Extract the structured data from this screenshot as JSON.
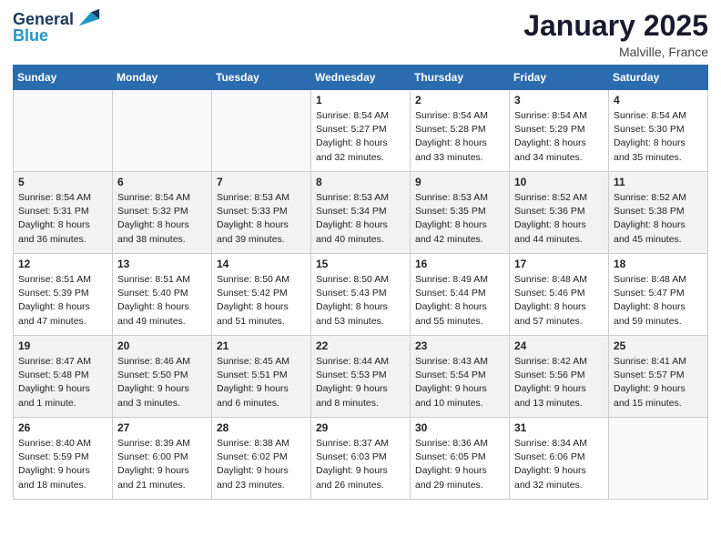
{
  "header": {
    "logo_line1": "General",
    "logo_line2": "Blue",
    "month": "January 2025",
    "location": "Malville, France"
  },
  "weekdays": [
    "Sunday",
    "Monday",
    "Tuesday",
    "Wednesday",
    "Thursday",
    "Friday",
    "Saturday"
  ],
  "weeks": [
    [
      {
        "day": "",
        "info": ""
      },
      {
        "day": "",
        "info": ""
      },
      {
        "day": "",
        "info": ""
      },
      {
        "day": "1",
        "info": "Sunrise: 8:54 AM\nSunset: 5:27 PM\nDaylight: 8 hours\nand 32 minutes."
      },
      {
        "day": "2",
        "info": "Sunrise: 8:54 AM\nSunset: 5:28 PM\nDaylight: 8 hours\nand 33 minutes."
      },
      {
        "day": "3",
        "info": "Sunrise: 8:54 AM\nSunset: 5:29 PM\nDaylight: 8 hours\nand 34 minutes."
      },
      {
        "day": "4",
        "info": "Sunrise: 8:54 AM\nSunset: 5:30 PM\nDaylight: 8 hours\nand 35 minutes."
      }
    ],
    [
      {
        "day": "5",
        "info": "Sunrise: 8:54 AM\nSunset: 5:31 PM\nDaylight: 8 hours\nand 36 minutes."
      },
      {
        "day": "6",
        "info": "Sunrise: 8:54 AM\nSunset: 5:32 PM\nDaylight: 8 hours\nand 38 minutes."
      },
      {
        "day": "7",
        "info": "Sunrise: 8:53 AM\nSunset: 5:33 PM\nDaylight: 8 hours\nand 39 minutes."
      },
      {
        "day": "8",
        "info": "Sunrise: 8:53 AM\nSunset: 5:34 PM\nDaylight: 8 hours\nand 40 minutes."
      },
      {
        "day": "9",
        "info": "Sunrise: 8:53 AM\nSunset: 5:35 PM\nDaylight: 8 hours\nand 42 minutes."
      },
      {
        "day": "10",
        "info": "Sunrise: 8:52 AM\nSunset: 5:36 PM\nDaylight: 8 hours\nand 44 minutes."
      },
      {
        "day": "11",
        "info": "Sunrise: 8:52 AM\nSunset: 5:38 PM\nDaylight: 8 hours\nand 45 minutes."
      }
    ],
    [
      {
        "day": "12",
        "info": "Sunrise: 8:51 AM\nSunset: 5:39 PM\nDaylight: 8 hours\nand 47 minutes."
      },
      {
        "day": "13",
        "info": "Sunrise: 8:51 AM\nSunset: 5:40 PM\nDaylight: 8 hours\nand 49 minutes."
      },
      {
        "day": "14",
        "info": "Sunrise: 8:50 AM\nSunset: 5:42 PM\nDaylight: 8 hours\nand 51 minutes."
      },
      {
        "day": "15",
        "info": "Sunrise: 8:50 AM\nSunset: 5:43 PM\nDaylight: 8 hours\nand 53 minutes."
      },
      {
        "day": "16",
        "info": "Sunrise: 8:49 AM\nSunset: 5:44 PM\nDaylight: 8 hours\nand 55 minutes."
      },
      {
        "day": "17",
        "info": "Sunrise: 8:48 AM\nSunset: 5:46 PM\nDaylight: 8 hours\nand 57 minutes."
      },
      {
        "day": "18",
        "info": "Sunrise: 8:48 AM\nSunset: 5:47 PM\nDaylight: 8 hours\nand 59 minutes."
      }
    ],
    [
      {
        "day": "19",
        "info": "Sunrise: 8:47 AM\nSunset: 5:48 PM\nDaylight: 9 hours\nand 1 minute."
      },
      {
        "day": "20",
        "info": "Sunrise: 8:46 AM\nSunset: 5:50 PM\nDaylight: 9 hours\nand 3 minutes."
      },
      {
        "day": "21",
        "info": "Sunrise: 8:45 AM\nSunset: 5:51 PM\nDaylight: 9 hours\nand 6 minutes."
      },
      {
        "day": "22",
        "info": "Sunrise: 8:44 AM\nSunset: 5:53 PM\nDaylight: 9 hours\nand 8 minutes."
      },
      {
        "day": "23",
        "info": "Sunrise: 8:43 AM\nSunset: 5:54 PM\nDaylight: 9 hours\nand 10 minutes."
      },
      {
        "day": "24",
        "info": "Sunrise: 8:42 AM\nSunset: 5:56 PM\nDaylight: 9 hours\nand 13 minutes."
      },
      {
        "day": "25",
        "info": "Sunrise: 8:41 AM\nSunset: 5:57 PM\nDaylight: 9 hours\nand 15 minutes."
      }
    ],
    [
      {
        "day": "26",
        "info": "Sunrise: 8:40 AM\nSunset: 5:59 PM\nDaylight: 9 hours\nand 18 minutes."
      },
      {
        "day": "27",
        "info": "Sunrise: 8:39 AM\nSunset: 6:00 PM\nDaylight: 9 hours\nand 21 minutes."
      },
      {
        "day": "28",
        "info": "Sunrise: 8:38 AM\nSunset: 6:02 PM\nDaylight: 9 hours\nand 23 minutes."
      },
      {
        "day": "29",
        "info": "Sunrise: 8:37 AM\nSunset: 6:03 PM\nDaylight: 9 hours\nand 26 minutes."
      },
      {
        "day": "30",
        "info": "Sunrise: 8:36 AM\nSunset: 6:05 PM\nDaylight: 9 hours\nand 29 minutes."
      },
      {
        "day": "31",
        "info": "Sunrise: 8:34 AM\nSunset: 6:06 PM\nDaylight: 9 hours\nand 32 minutes."
      },
      {
        "day": "",
        "info": ""
      }
    ]
  ]
}
